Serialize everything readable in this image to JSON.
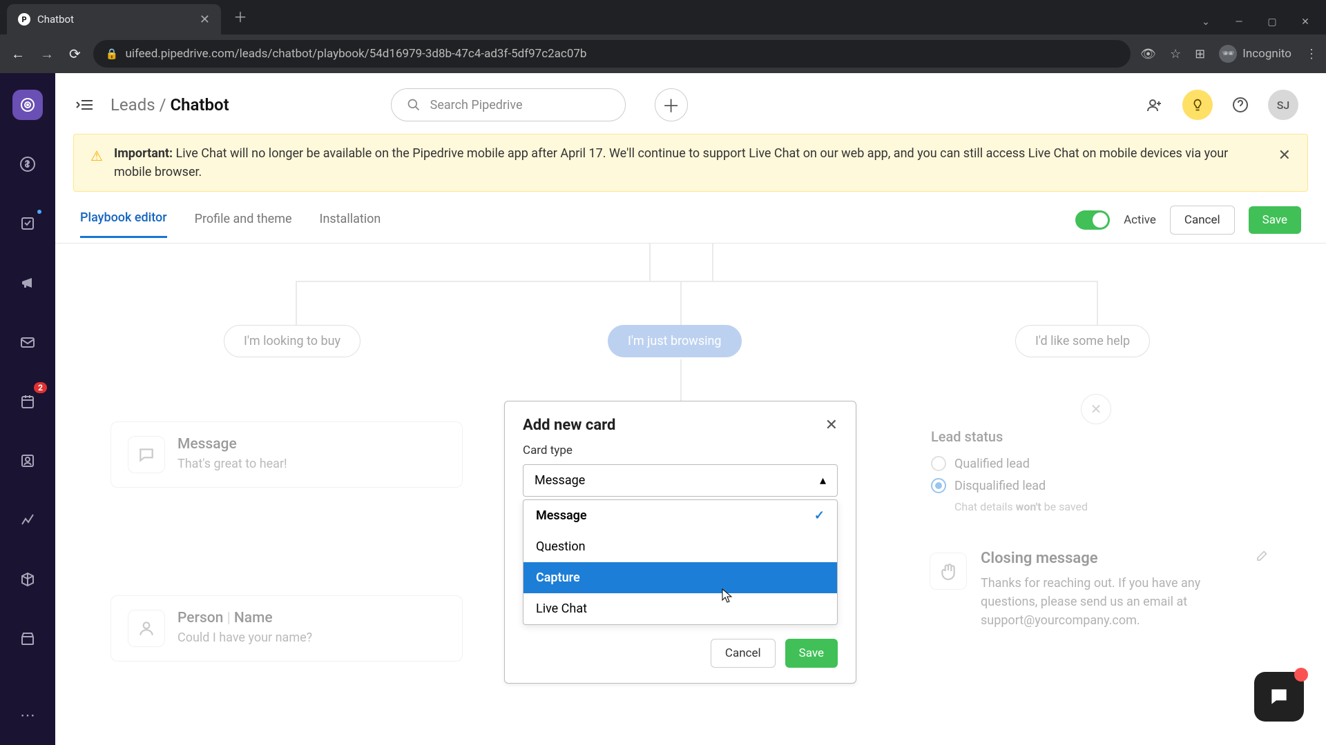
{
  "browser": {
    "tab_title": "Chatbot",
    "url": "uifeed.pipedrive.com/leads/chatbot/playbook/54d16979-3d8b-47c4-ad3f-5df97c2ac07b",
    "incognito_label": "Incognito"
  },
  "header": {
    "breadcrumb_parent": "Leads",
    "breadcrumb_sep": "/",
    "breadcrumb_current": "Chatbot",
    "search_placeholder": "Search Pipedrive",
    "avatar_initials": "SJ"
  },
  "banner": {
    "prefix": "Important:",
    "text": " Live Chat will no longer be available on the Pipedrive mobile app after April 17. We'll continue to support Live Chat on our web app, and you can still access Live Chat on mobile devices via your mobile browser."
  },
  "tabs": {
    "items": [
      "Playbook editor",
      "Profile and theme",
      "Installation"
    ],
    "active_label": "Active",
    "cancel": "Cancel",
    "save": "Save"
  },
  "sidebar": {
    "badge_count": "2"
  },
  "canvas": {
    "pills": [
      "I'm looking to buy",
      "I'm just browsing",
      "I'd like some help"
    ],
    "message_card": {
      "title": "Message",
      "sub": "That's great to hear!"
    },
    "person_card": {
      "title_a": "Person",
      "sep": " | ",
      "title_b": "Name",
      "sub": "Could I have your name?"
    },
    "lead_status": {
      "title": "Lead status",
      "opt1": "Qualified lead",
      "opt2": "Disqualified lead",
      "hint_pre": "Chat details ",
      "hint_bold": "won't",
      "hint_post": " be saved"
    },
    "closing": {
      "title": "Closing message",
      "text": "Thanks for reaching out. If you have any questions, please send us an email at support@yourcompany.com."
    }
  },
  "modal": {
    "title": "Add new card",
    "field_label": "Card type",
    "selected": "Message",
    "options": [
      "Message",
      "Question",
      "Capture",
      "Live Chat"
    ],
    "cancel": "Cancel",
    "save": "Save"
  }
}
